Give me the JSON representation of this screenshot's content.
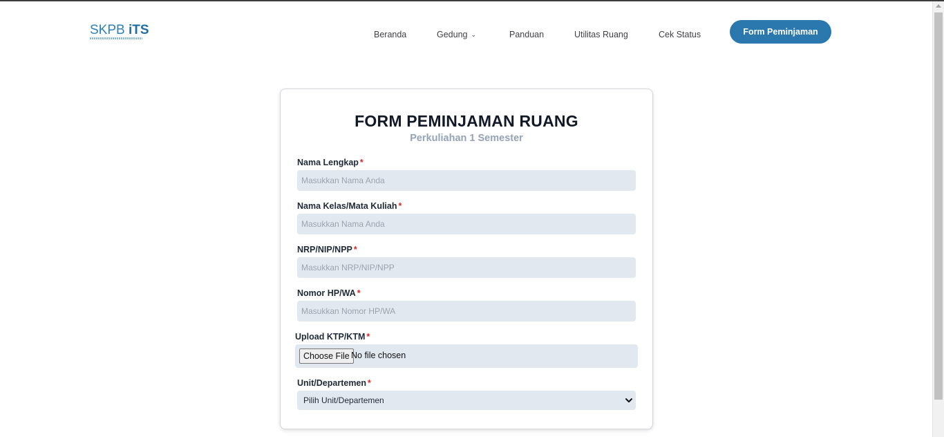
{
  "brand": {
    "logo_main": "SKPB ",
    "logo_accent": "iTS"
  },
  "nav": {
    "items": [
      {
        "label": "Beranda",
        "has_dropdown": false
      },
      {
        "label": "Gedung",
        "has_dropdown": true
      },
      {
        "label": "Panduan",
        "has_dropdown": false
      },
      {
        "label": "Utilitas Ruang",
        "has_dropdown": false
      },
      {
        "label": "Cek Status",
        "has_dropdown": false
      }
    ],
    "cta_label": "Form Peminjaman"
  },
  "form": {
    "title": "FORM PEMINJAMAN RUANG",
    "subtitle": "Perkuliahan 1 Semester",
    "required_mark": "*",
    "fields": {
      "nama_lengkap": {
        "label": "Nama Lengkap",
        "placeholder": "Masukkan Nama Anda",
        "value": ""
      },
      "nama_kelas": {
        "label": "Nama Kelas/Mata Kuliah",
        "placeholder": "Masukkan Nama Anda",
        "value": ""
      },
      "nrp": {
        "label": "NRP/NIP/NPP",
        "placeholder": "Masukkan NRP/NIP/NPP",
        "value": ""
      },
      "nomor_hp": {
        "label": "Nomor HP/WA",
        "placeholder": "Masukkan Nomor HP/WA",
        "value": ""
      },
      "upload": {
        "label": "Upload KTP/KTM",
        "button_label": "Choose File",
        "status": "No file chosen"
      },
      "unit": {
        "label": "Unit/Departemen",
        "selected": "Pilih Unit/Departemen"
      }
    }
  },
  "colors": {
    "accent": "#2b78ae",
    "input_bg": "#e2e8f0",
    "subtitle": "#94a3b8",
    "required": "#dc2626"
  }
}
